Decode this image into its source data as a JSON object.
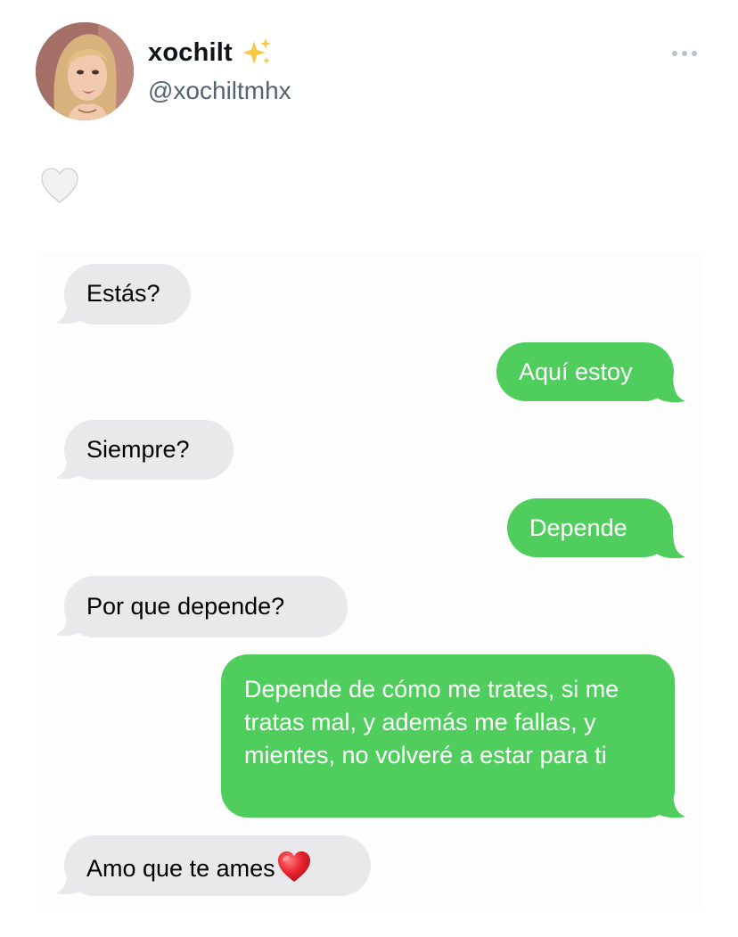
{
  "author": {
    "display_name": "xochilt",
    "name_emoji": "sparkles-icon",
    "handle": "@xochiltmhx"
  },
  "tweet": {
    "text_emoji": "white-heart-icon"
  },
  "conversation": {
    "colors": {
      "incoming": "#e9e9eb",
      "outgoing": "#4fcd5d"
    },
    "messages": [
      {
        "from": "them",
        "text": "Estás?"
      },
      {
        "from": "me",
        "text": "Aquí estoy"
      },
      {
        "from": "them",
        "text": "Siempre?"
      },
      {
        "from": "me",
        "text": "Depende"
      },
      {
        "from": "them",
        "text": "Por que depende?"
      },
      {
        "from": "me",
        "text": "Depende de cómo me trates, si me tratas mal, y además me fallas, y mientes, no volveré a estar para ti"
      },
      {
        "from": "them",
        "text": "Amo que te ames",
        "emoji": "red-heart-icon"
      }
    ]
  }
}
